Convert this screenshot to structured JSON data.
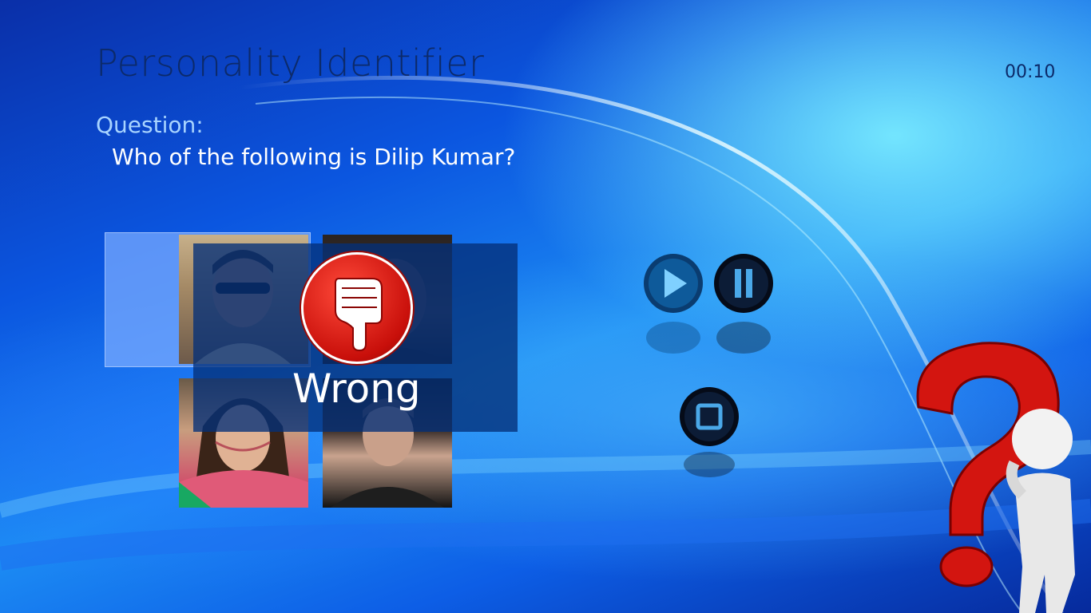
{
  "app": {
    "title": "Personality Identifier",
    "timer": "00:10"
  },
  "question": {
    "label": "Question:",
    "text": "Who of the following is Dilip Kumar?"
  },
  "options": [
    {
      "name": "option-photo-1"
    },
    {
      "name": "option-photo-2"
    },
    {
      "name": "option-photo-3"
    },
    {
      "name": "option-photo-4"
    }
  ],
  "feedback": {
    "result": "Wrong",
    "icon": "thumbs-down-icon"
  },
  "controls": {
    "play": "play-icon",
    "pause": "pause-icon",
    "stop": "stop-icon"
  },
  "decor": {
    "mascot": "question-mark-figure-icon",
    "accent": "#c80f0a"
  }
}
